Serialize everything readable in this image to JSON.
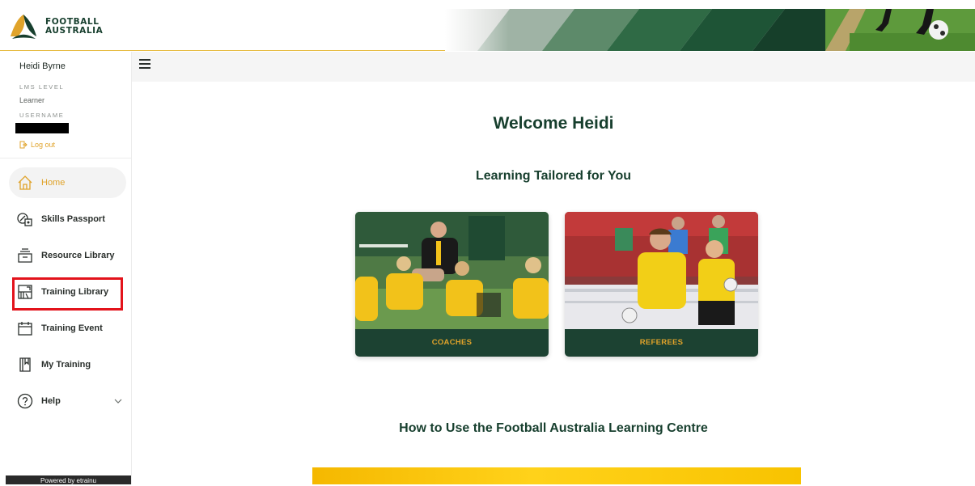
{
  "brand": {
    "line1": "FOOTBALL",
    "line2": "AUSTRALIA"
  },
  "sidebar": {
    "user_name": "Heidi Byrne",
    "lms_level_label": "LMS LEVEL",
    "lms_level_value": "Learner",
    "username_label": "USERNAME",
    "logout": "Log out",
    "items": [
      {
        "label": "Home",
        "icon": "home-icon",
        "active": true
      },
      {
        "label": "Skills Passport",
        "icon": "skills-passport-icon"
      },
      {
        "label": "Resource Library",
        "icon": "resource-library-icon"
      },
      {
        "label": "Training Library",
        "icon": "training-library-icon"
      },
      {
        "label": "Training Event",
        "icon": "calendar-icon"
      },
      {
        "label": "My Training",
        "icon": "book-icon"
      },
      {
        "label": "Help",
        "icon": "help-icon"
      }
    ],
    "powered_by": "Powered by etrainu"
  },
  "main": {
    "welcome": "Welcome Heidi",
    "tailored": "Learning Tailored for You",
    "cards": [
      {
        "label": "COACHES"
      },
      {
        "label": "REFEREES"
      }
    ],
    "how_to": "How to Use the Football Australia Learning Centre"
  },
  "colors": {
    "brand_green": "#173f2e",
    "brand_gold": "#e0a32a",
    "highlight_red": "#e3131b"
  }
}
